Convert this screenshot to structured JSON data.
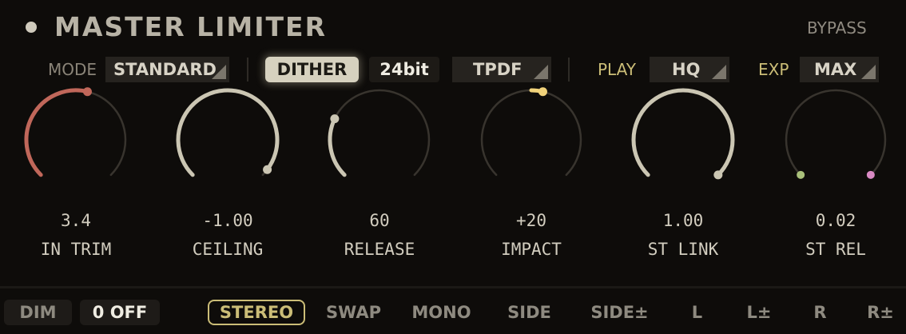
{
  "header": {
    "title": "MASTER LIMITER",
    "bypass_label": "BYPASS"
  },
  "controls": {
    "mode_label": "MODE",
    "mode_value": "STANDARD",
    "dither_label": "DITHER",
    "bit_depth": "24bit",
    "noise_shape": "TPDF",
    "play_label": "PLAY",
    "play_value": "HQ",
    "exp_label": "EXP",
    "exp_value": "MAX"
  },
  "knobs": [
    {
      "value": "3.4",
      "label": "IN TRIM",
      "fraction": 0.55,
      "color": "#c0675a",
      "mode": "from-min"
    },
    {
      "value": "-1.00",
      "label": "CEILING",
      "fraction": 0.97,
      "color": "#cbc6b3",
      "mode": "from-min"
    },
    {
      "value": "60",
      "label": "RELEASE",
      "fraction": 0.26,
      "color": "#cbc6b3",
      "mode": "from-min"
    },
    {
      "value": "+20",
      "label": "IMPACT",
      "fraction": 0.55,
      "color": "#f0d27a",
      "mode": "from-center"
    },
    {
      "value": "1.00",
      "label": "ST LINK",
      "fraction": 1.0,
      "color": "#cbc6b3",
      "mode": "full"
    },
    {
      "value": "0.02",
      "label": "ST REL",
      "fraction": 0.0,
      "color": "#a9c07a",
      "color2": "#d98ac4",
      "mode": "dual"
    }
  ],
  "monitor": {
    "dim_label": "DIM",
    "off_label": "0 OFF",
    "modes": [
      "STEREO",
      "SWAP",
      "MONO",
      "SIDE",
      "SIDE±",
      "L",
      "L±",
      "R",
      "R±"
    ],
    "active_mode": "STEREO",
    "accent": "#cbbd77"
  }
}
